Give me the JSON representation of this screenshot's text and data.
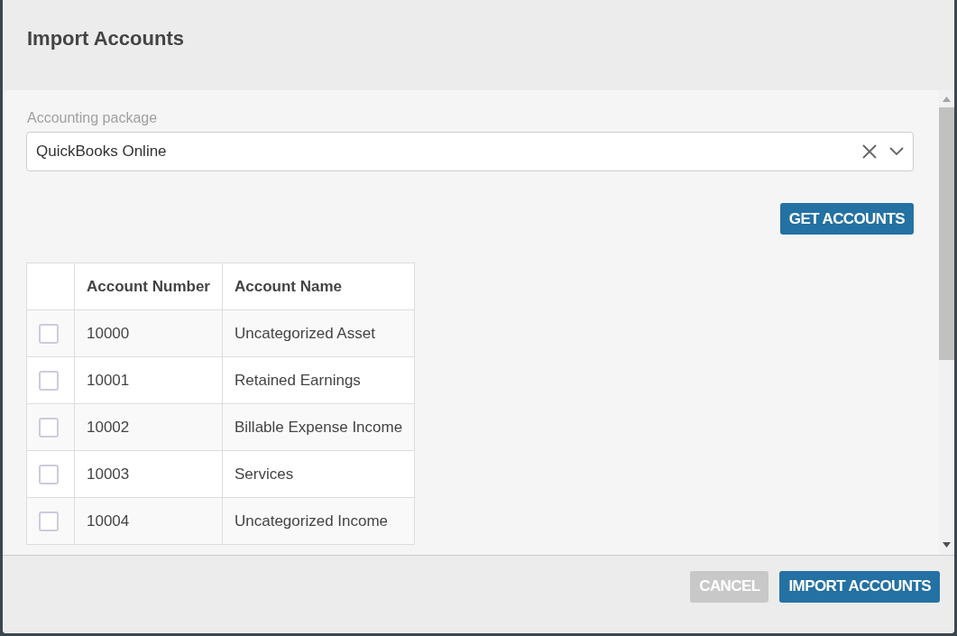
{
  "dialog": {
    "title": "Import Accounts"
  },
  "accounting_package": {
    "label": "Accounting package",
    "value": "QuickBooks Online"
  },
  "get_accounts_button": "GET ACCOUNTS",
  "table": {
    "columns": [
      "Account Number",
      "Account Name"
    ],
    "rows": [
      {
        "checked": false,
        "number": "10000",
        "name": "Uncategorized Asset"
      },
      {
        "checked": false,
        "number": "10001",
        "name": "Retained Earnings"
      },
      {
        "checked": false,
        "number": "10002",
        "name": "Billable Expense Income"
      },
      {
        "checked": false,
        "number": "10003",
        "name": "Services"
      },
      {
        "checked": false,
        "number": "10004",
        "name": "Uncategorized Income"
      }
    ]
  },
  "footer_buttons": [
    {
      "label": "CANCEL",
      "disabled": true
    },
    {
      "label": "IMPORT ACCOUNTS",
      "disabled": false
    }
  ]
}
